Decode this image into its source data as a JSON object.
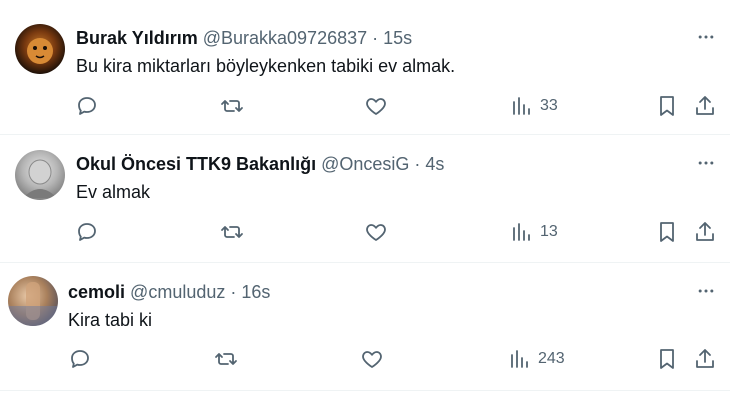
{
  "tweets": [
    {
      "name": "Burak Yıldırım",
      "handle": "@Burakka09726837",
      "separator": "·",
      "time": "15s",
      "text": "Bu kira miktarları böyleykenken tabiki ev almak.",
      "views": "33",
      "avatar": "lion-avatar"
    },
    {
      "name": "Okul Öncesi TTK9 Bakanlığı",
      "handle": "@OncesiG",
      "separator": "·",
      "time": "4s",
      "text": "Ev almak",
      "views": "13",
      "avatar": "grayscale-portrait-avatar"
    },
    {
      "name": "cemoli",
      "handle": "@cmuluduz",
      "separator": "·",
      "time": "16s",
      "text": "Kira tabi ki",
      "views": "243",
      "avatar": "photo-avatar"
    }
  ],
  "colors": {
    "text_primary": "#0f1419",
    "text_secondary": "#536471",
    "divider": "#eff3f4",
    "background": "#ffffff"
  },
  "icons": [
    "reply-icon",
    "retweet-icon",
    "like-icon",
    "views-icon",
    "bookmark-icon",
    "share-icon",
    "more-icon"
  ]
}
